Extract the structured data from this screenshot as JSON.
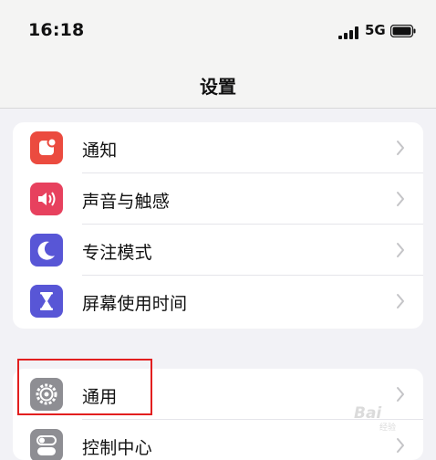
{
  "status_bar": {
    "time": "16:18",
    "network": "5G",
    "signal_icon": "signal-bars-icon",
    "battery_icon": "battery-icon"
  },
  "nav": {
    "title": "设置"
  },
  "groups": [
    {
      "items": [
        {
          "label": "通知",
          "icon": "notifications-icon",
          "color": "#eb4b3f"
        },
        {
          "label": "声音与触感",
          "icon": "sound-icon",
          "color": "#e7415e"
        },
        {
          "label": "专注模式",
          "icon": "moon-icon",
          "color": "#5856d6"
        },
        {
          "label": "屏幕使用时间",
          "icon": "hourglass-icon",
          "color": "#5856d6"
        }
      ]
    },
    {
      "items": [
        {
          "label": "通用",
          "icon": "gear-icon",
          "color": "#8e8e93"
        },
        {
          "label": "控制中心",
          "icon": "toggle-icon",
          "color": "#8e8e93"
        }
      ]
    }
  ],
  "annotation": {
    "highlight_color": "#e21f1f",
    "highlighted_item": "通用"
  },
  "watermark": {
    "text": "Bai",
    "sub": "经验"
  }
}
